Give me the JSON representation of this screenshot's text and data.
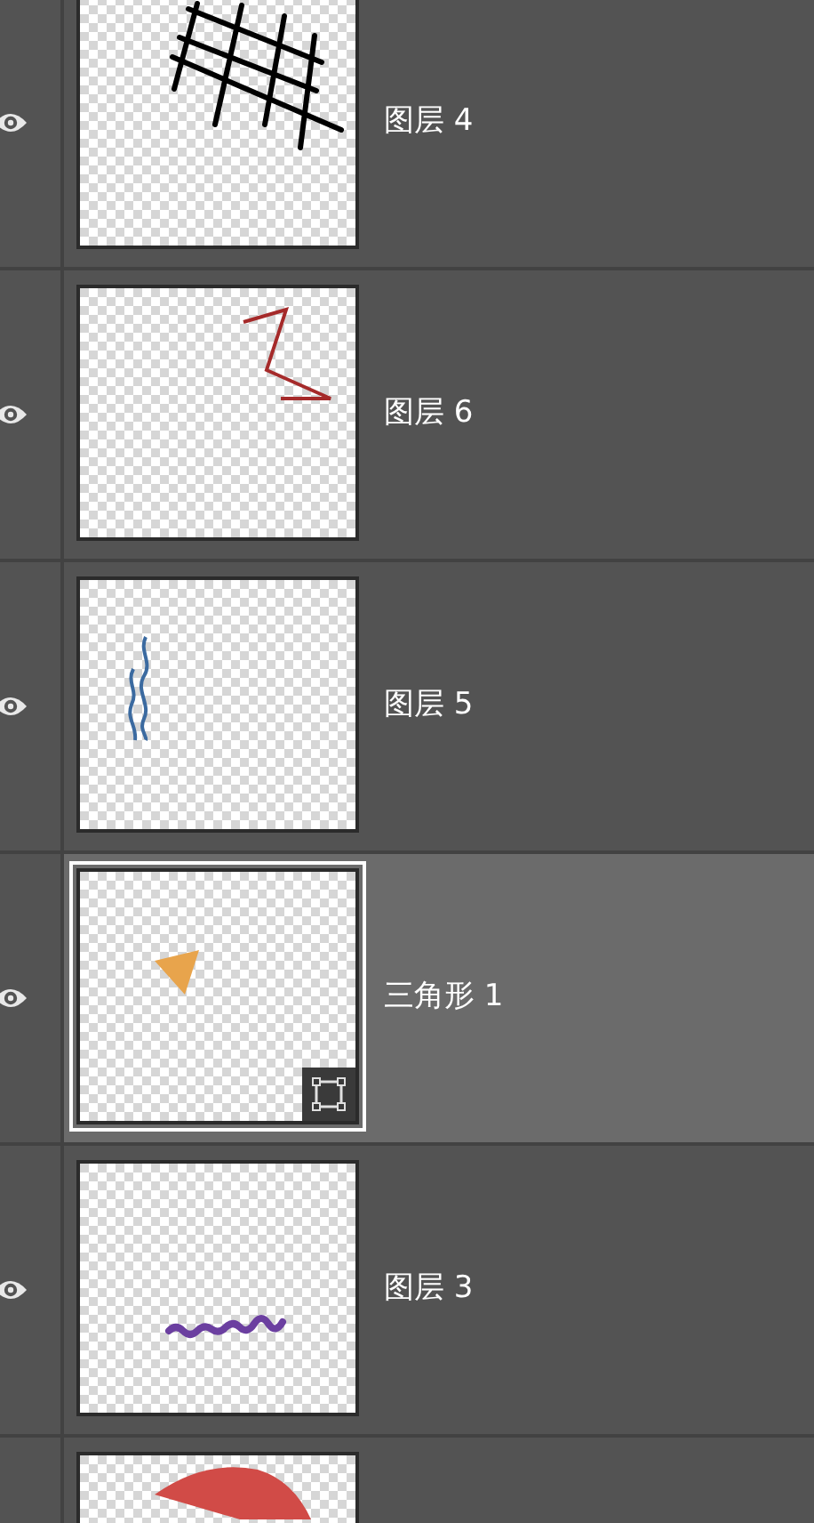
{
  "layers": [
    {
      "label": "图层 4",
      "visible": true,
      "selected": false,
      "shape_layer": false,
      "kind": "grid"
    },
    {
      "label": "图层 6",
      "visible": true,
      "selected": false,
      "shape_layer": false,
      "kind": "zigzag"
    },
    {
      "label": "图层 5",
      "visible": true,
      "selected": false,
      "shape_layer": false,
      "kind": "squiggle"
    },
    {
      "label": "三角形 1",
      "visible": true,
      "selected": true,
      "shape_layer": true,
      "kind": "triangle"
    },
    {
      "label": "图层 3",
      "visible": true,
      "selected": false,
      "shape_layer": false,
      "kind": "wave"
    },
    {
      "selected": false,
      "kind": "semicircle"
    }
  ]
}
